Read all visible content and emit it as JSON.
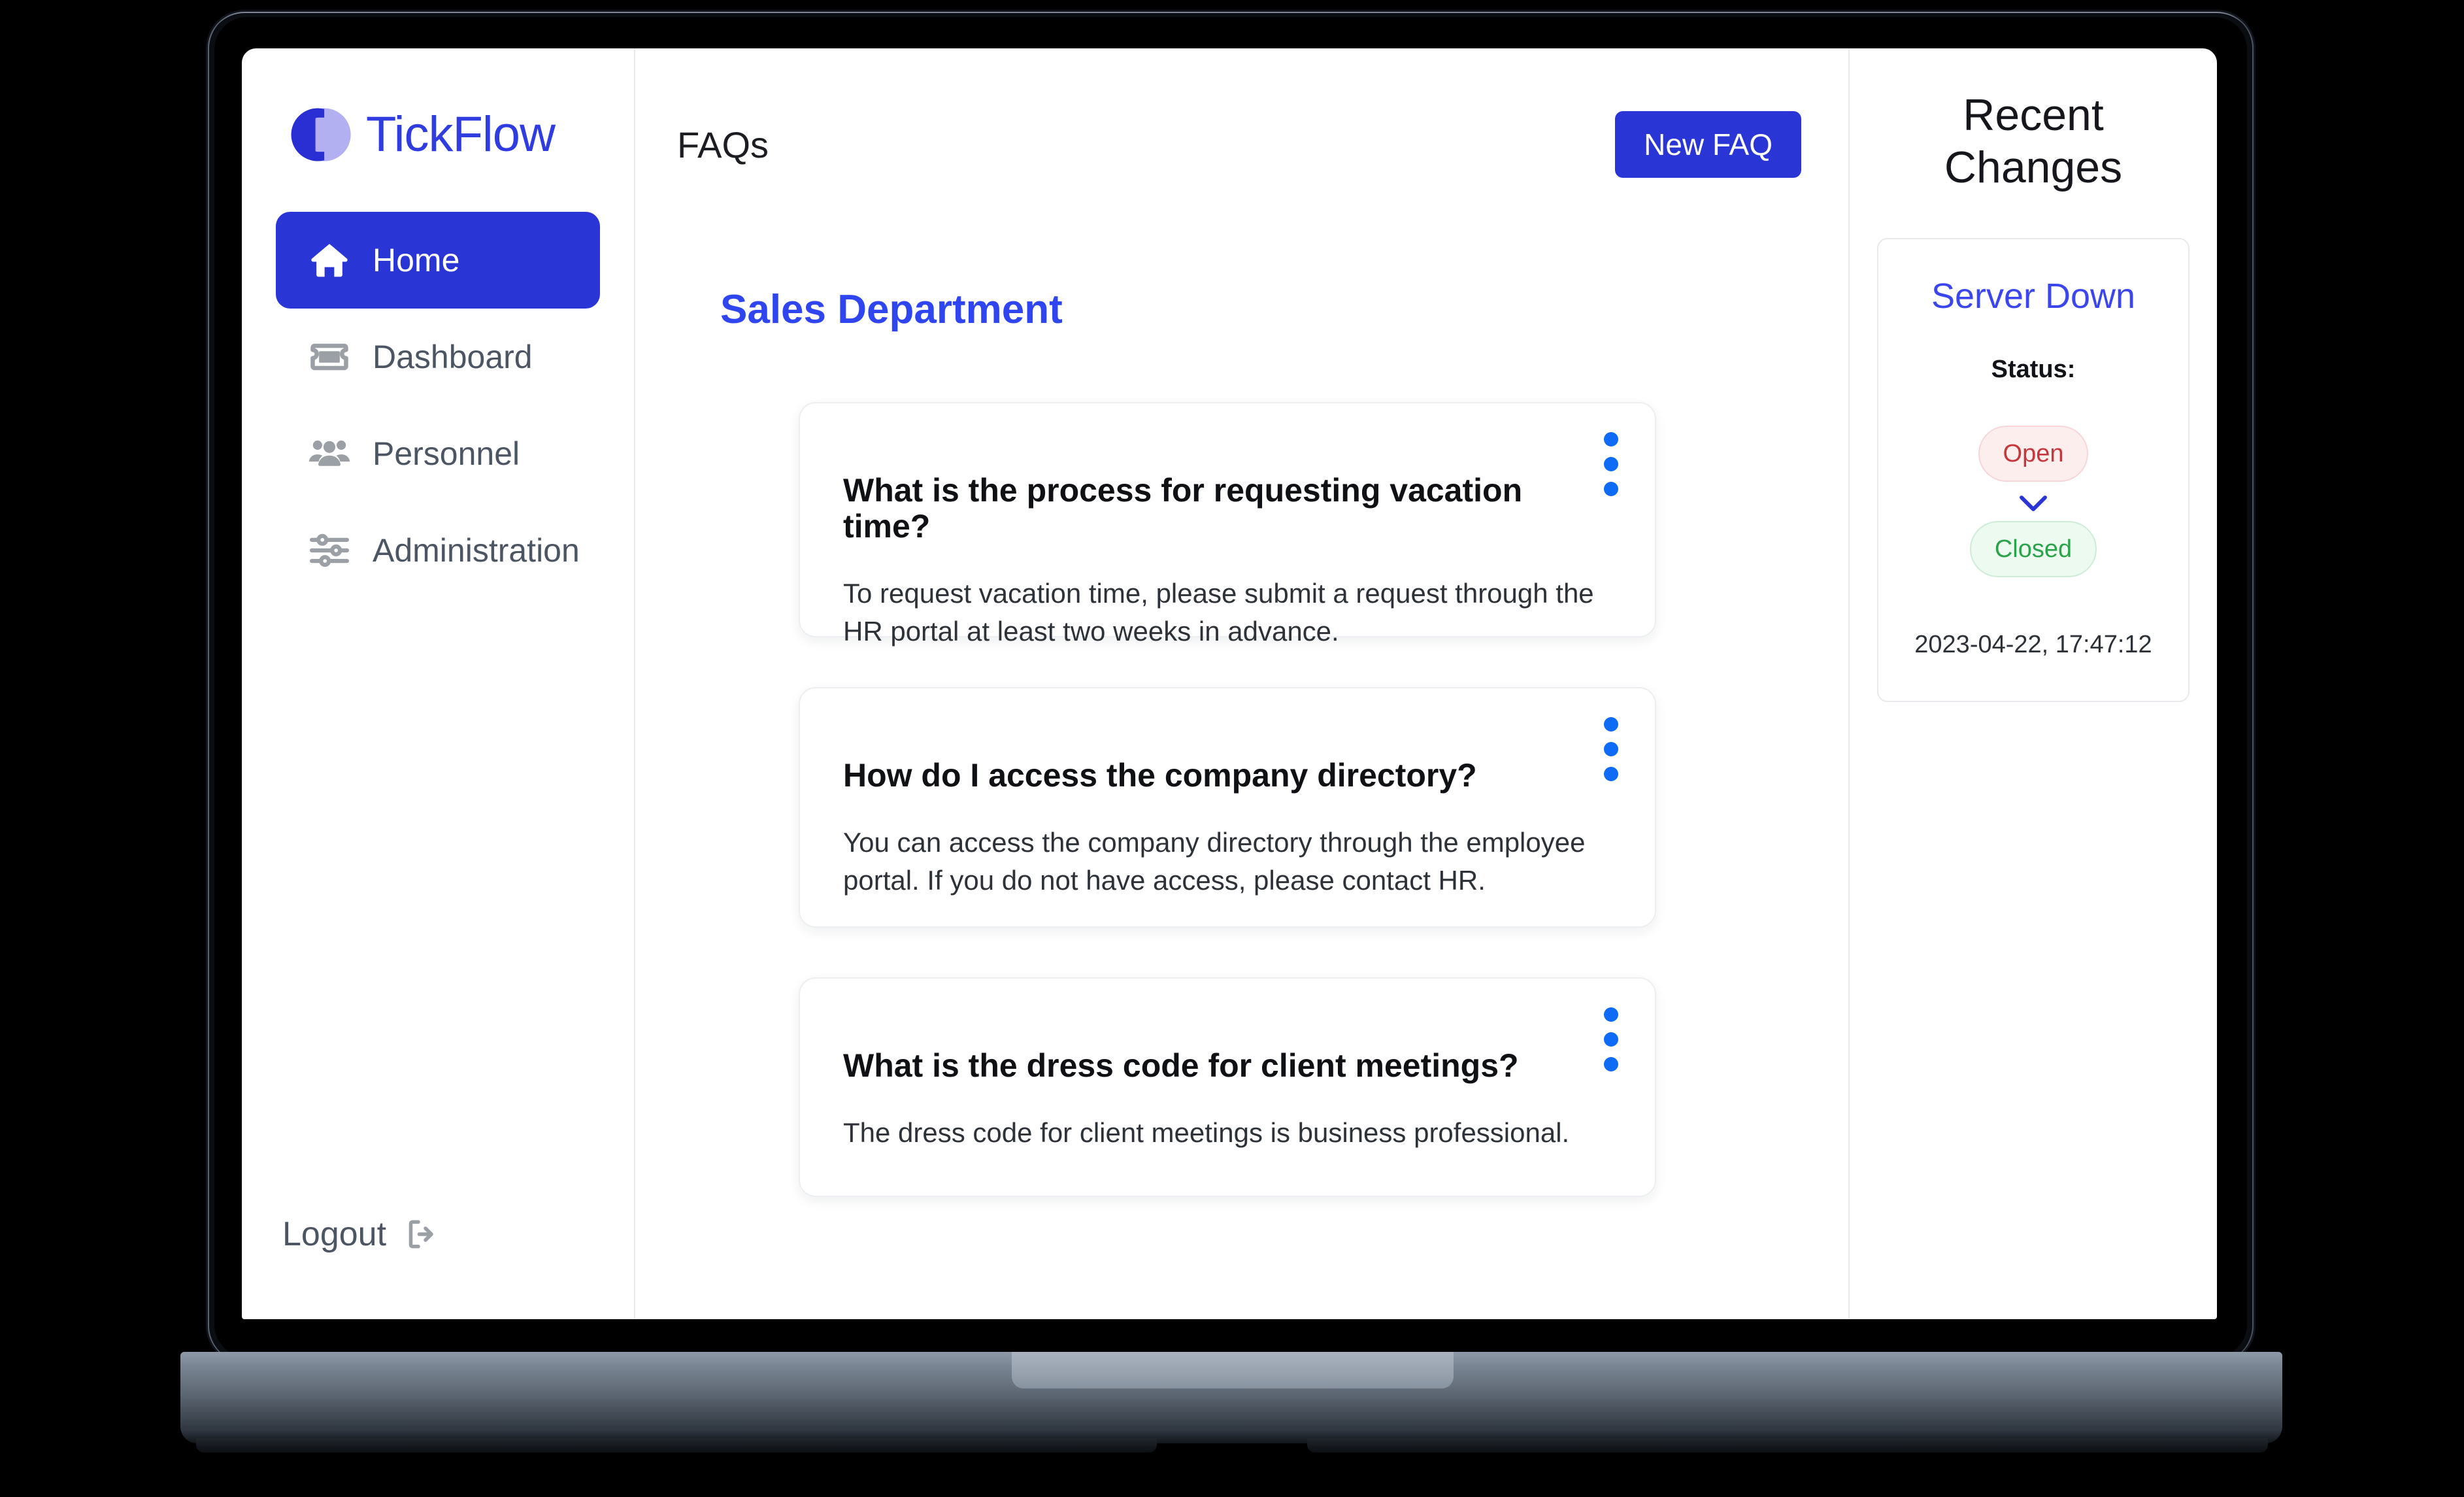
{
  "brand": {
    "name": "TickFlow",
    "mark": "tickflow-logo-icon",
    "color": "#2f3ce0"
  },
  "sidebar": {
    "items": [
      {
        "label": "Home",
        "icon": "home-icon",
        "active": true
      },
      {
        "label": "Dashboard",
        "icon": "ticket-icon",
        "active": false
      },
      {
        "label": "Personnel",
        "icon": "people-group-icon",
        "active": false
      },
      {
        "label": "Administration",
        "icon": "sliders-icon",
        "active": false
      }
    ],
    "logout": {
      "label": "Logout",
      "icon": "logout-arrow-icon"
    }
  },
  "header": {
    "title": "FAQs",
    "new_button": "New FAQ",
    "accent": "#2a35d6"
  },
  "main": {
    "department_title": "Sales Department",
    "faqs": [
      {
        "question": "What is the process for requesting vacation time?",
        "answer": "To request vacation time, please submit a request through the HR portal at least two weeks in advance.",
        "menu_icon": "kebab-menu-icon"
      },
      {
        "question": "How do I access the company directory?",
        "answer": "You can access the company directory through the employee portal. If you do not have access, please contact HR.",
        "menu_icon": "kebab-menu-icon"
      },
      {
        "question": "What is the dress code for client meetings?",
        "answer": "The dress code for client meetings is business professional.",
        "menu_icon": "kebab-menu-icon"
      }
    ]
  },
  "right_panel": {
    "title": "Recent Changes",
    "card": {
      "title": "Server Down",
      "status_label": "Status:",
      "from_status": "Open",
      "to_status": "Closed",
      "transition_icon": "chevron-down-icon",
      "timestamp": "2023-04-22, 17:47:12",
      "open_color": "#c5373b",
      "closed_color": "#2aa34a"
    }
  }
}
